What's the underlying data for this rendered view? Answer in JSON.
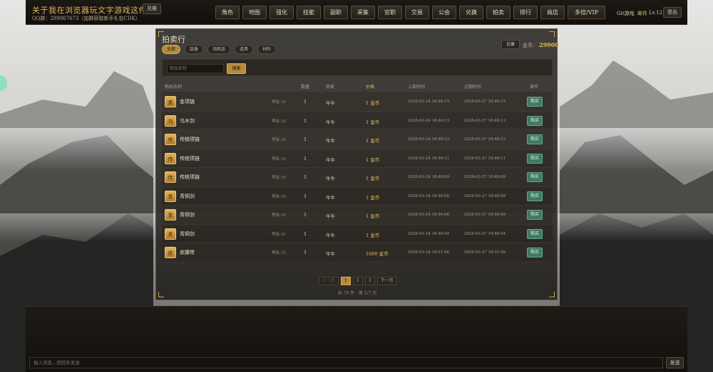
{
  "header": {
    "game_title": "关于我在浏览器玩文字游戏这件事",
    "redeem_label": "兑换",
    "qq_line": "QQ群：289867673（加群获取新手礼包CDK）",
    "nav": [
      "角色",
      "地图",
      "强化",
      "技能",
      "副职",
      "采集",
      "官职",
      "交易",
      "公会",
      "兑换",
      "拍卖",
      "排行",
      "商店",
      "多倍/VIP"
    ],
    "user_name": "Git游戏",
    "mail_label": "邮件",
    "level_text": "Lv.12",
    "logout_label": "登出"
  },
  "auction": {
    "title": "拍卖行",
    "tabs": [
      "全部",
      "装备",
      "消耗品",
      "道具",
      "材料"
    ],
    "active_tab": 0,
    "record_label": "记录",
    "gold_label": "金币:",
    "gold_value": "29900",
    "search_placeholder": "物品名称",
    "search_button": "搜索",
    "columns": {
      "name": "物品名称",
      "qty": "数量",
      "seller": "卖家",
      "price": "价格",
      "listed": "上架时间",
      "expire": "过期时间",
      "action": "操作"
    },
    "rows": [
      {
        "icon": "金",
        "name": "金项链",
        "level": "等级 10",
        "qty": "1",
        "seller": "牛牛",
        "price": "1 金币",
        "listed": "2026-03-24 18:46:15",
        "expire": "2026-03-27 18:46:15",
        "action": "购买"
      },
      {
        "icon": "乌",
        "name": "乌木剑",
        "level": "等级 20",
        "qty": "1",
        "seller": "牛牛",
        "price": "1 金币",
        "listed": "2026-03-24 18:46:13",
        "expire": "2026-03-27 18:46:13",
        "action": "购买"
      },
      {
        "icon": "传",
        "name": "传统项链",
        "level": "等级 30",
        "qty": "1",
        "seller": "牛牛",
        "price": "1 金币",
        "listed": "2026-03-24 18:46:12",
        "expire": "2026-03-27 18:46:12",
        "action": "购买"
      },
      {
        "icon": "传",
        "name": "传统项链",
        "level": "等级 30",
        "qty": "1",
        "seller": "牛牛",
        "price": "1 金币",
        "listed": "2026-03-24 18:46:11",
        "expire": "2026-03-27 18:46:11",
        "action": "购买"
      },
      {
        "icon": "传",
        "name": "传统项链",
        "level": "等级 30",
        "qty": "1",
        "seller": "牛牛",
        "price": "1 金币",
        "listed": "2026-03-24 18:46:09",
        "expire": "2026-03-27 18:46:09",
        "action": "购买"
      },
      {
        "icon": "青",
        "name": "青铜剑",
        "level": "等级 40",
        "qty": "1",
        "seller": "牛牛",
        "price": "1 金币",
        "listed": "2026-03-24 18:46:08",
        "expire": "2026-03-27 18:46:08",
        "action": "购买"
      },
      {
        "icon": "青",
        "name": "青铜剑",
        "level": "等级 40",
        "qty": "1",
        "seller": "牛牛",
        "price": "1 金币",
        "listed": "2026-03-24 18:46:06",
        "expire": "2026-03-27 18:46:06",
        "action": "购买"
      },
      {
        "icon": "青",
        "name": "青铜剑",
        "level": "等级 40",
        "qty": "1",
        "seller": "牛牛",
        "price": "1 金币",
        "listed": "2026-03-24 18:46:04",
        "expire": "2026-03-27 18:46:04",
        "action": "购买"
      },
      {
        "icon": "皮",
        "name": "皮腰带",
        "level": "等级 25",
        "qty": "1",
        "seller": "牛牛",
        "price": "1000 金币",
        "listed": "2026-03-24 18:31:56",
        "expire": "2026-03-27 18:31:56",
        "action": "购买"
      }
    ],
    "pager": {
      "prev": "上一页",
      "pages": [
        "1",
        "2",
        "3"
      ],
      "current": "1",
      "next": "下一页",
      "info": "共 79 件 · 第 1/7 页"
    }
  },
  "chat": {
    "placeholder": "输入消息...按回车发送",
    "send_label": "发送"
  },
  "colors": {
    "accent_gold": "#e5b85a",
    "buy_green": "#3f7a62",
    "panel_bg": "#181511"
  }
}
